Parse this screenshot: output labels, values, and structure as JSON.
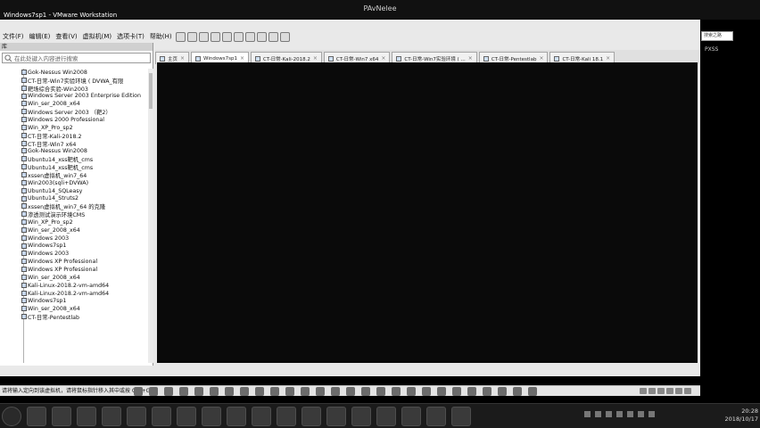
{
  "top": {
    "title": "PAvNelee",
    "vm_title": "Windows7sp1 - VMware Workstation"
  },
  "menu": [
    "文件(F)",
    "编辑(E)",
    "查看(V)",
    "虚拟机(M)",
    "选项卡(T)",
    "帮助(H)"
  ],
  "right_field": "搜索之路",
  "right_tag": "PXSS",
  "sidebar": {
    "header": "库",
    "search_placeholder": "在此处键入内容进行搜索",
    "items": [
      "Gok-Nessus Win2008",
      "CT-日常-Win7实验环境 ( DVWA_有限",
      "靶场综合实验-Win2003",
      "Windows Server 2003 Enterprise Edition",
      "Win_ser_2008_x64",
      "Windows Server 2003 （靶2）",
      "Windows 2000 Professional",
      "Win_XP_Pro_sp2",
      "CT-日常-Kali-2018.2",
      "CT-日常-Win7 x64",
      "Gok-Nessus Win2008",
      "Ubuntu14_xss靶机_cms",
      "Ubuntu14_xss靶机_cms",
      "xssen虚拟机_win7_64",
      "Win2003(sqli+DVWA)",
      "Ubuntu14_SQLeasy",
      "Ubuntu14_Struts2",
      "xssen虚拟机_win7_64 的克隆",
      "渗透测试演示环境CMS",
      "Win_XP_Pro_sp2",
      "Win_ser_2008_x64",
      "Windows 2003",
      "Windows7sp1",
      "Windows 2003",
      "Windows XP Professional",
      "Windows XP Professional",
      "Win_ser_2008_x64",
      "Kali-Linux-2018.2-vm-amd64",
      "Kali-Linux-2018.2-vm-amd64",
      "Windows7sp1",
      "Win_ser_2008_x64",
      "CT-日常-Pentestlab"
    ]
  },
  "tabs": [
    {
      "label": "主页",
      "active": false
    },
    {
      "label": "Windows7sp1",
      "active": true
    },
    {
      "label": "CT-日常-Kali-2018.2",
      "active": false
    },
    {
      "label": "CT-日常-Win7 x64",
      "active": false
    },
    {
      "label": "CT-日常-Win7实验环境 ( ...",
      "active": false
    },
    {
      "label": "CT-日常-Pentestlab",
      "active": false
    },
    {
      "label": "CT-日常-Kali 18.1",
      "active": false
    }
  ],
  "statusbar": "请将输入定向到该虚拟机，请将鼠标指针移入其中或按 Ctrl+G。",
  "clock": {
    "time": "20:28",
    "date": "2018/10/17"
  }
}
